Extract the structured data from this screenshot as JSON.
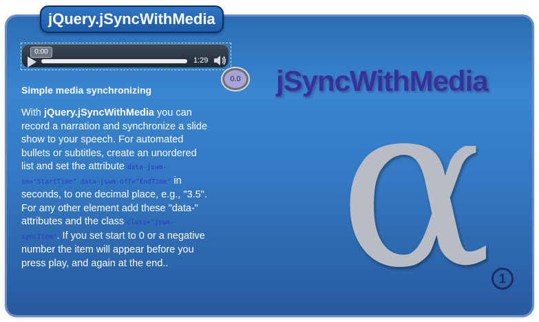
{
  "header": {
    "title": "jQuery.jSyncWithMedia"
  },
  "player": {
    "current_time": "0:00",
    "duration": "1:29",
    "progress_fraction": 0
  },
  "sync_indicator": "0.0",
  "intro": {
    "subtitle": "Simple media synchronizing",
    "p1": "With ",
    "plugin_name": "jQuery.jSyncWithMedia",
    "p2": " you can record a narration and synchronize a slide show to your speech. For automated bullets or subtitles, create an unordered list and set the attribute ",
    "code1": "data-jswm-on=\"StartTime\" data-jswm-off=\"EndTime\"",
    "p3": " in seconds, to one decimal place, e.g., \"3.5\". For any other element add these \"data-\" attributes and the class ",
    "code2": "class=\"jswm-syncItem\"",
    "p4": ". If you set start to 0 or a negative number the item will appear before you press play, and again at the end.."
  },
  "brand": {
    "wordmark": "jSyncWithMedia",
    "symbol": "α",
    "version_mark": "1"
  },
  "colors": {
    "panel_top": "#2a6db5",
    "panel_bottom": "#275a9e",
    "wordmark": "#343399",
    "alpha": "#b8bdc3",
    "code": "#2b3bbf"
  }
}
